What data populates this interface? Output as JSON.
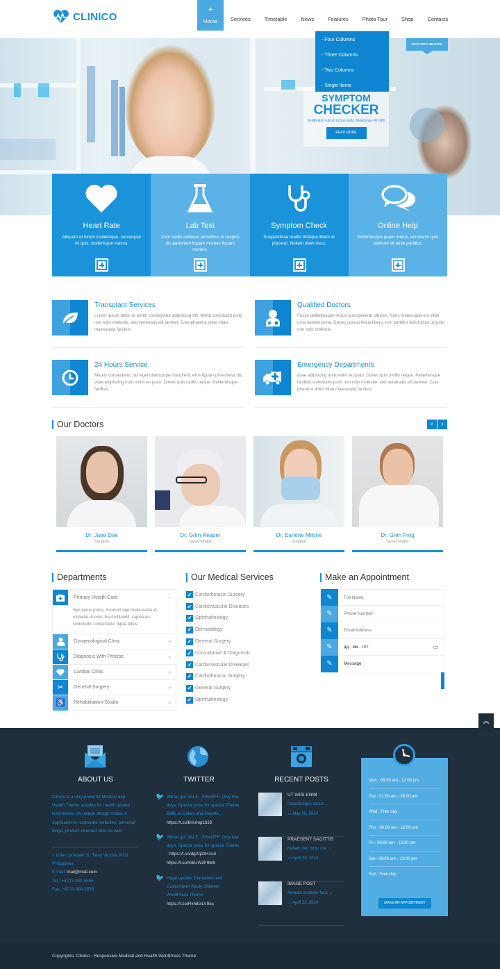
{
  "header": {
    "logo_text": "CLINICO",
    "nav": [
      {
        "label": "Home",
        "active": true
      },
      {
        "label": "Services"
      },
      {
        "label": "Timetable"
      },
      {
        "label": "News"
      },
      {
        "label": "Features"
      },
      {
        "label": "Photo Tour"
      },
      {
        "label": "Shop"
      },
      {
        "label": "Contacts"
      }
    ],
    "home_plus": "+",
    "dropdown": [
      "- Four Columns",
      "- Three Columns",
      "- Two Columns",
      "- Single Items"
    ]
  },
  "hero": {
    "doctors_search": "DOCTOR'S SEARCH",
    "symptom_line1": "SYMPTOM",
    "symptom_line2": "CHECKER",
    "symptom_sub": "Vestibulum rutrum luctus porta. Maecenas elit nibh",
    "read_more": "READ MORE"
  },
  "features": [
    {
      "icon": "heart-icon",
      "title": "Heart Rate",
      "desc": "Aliquam ut lorem scelerisque, consequat mi quis, scelerisque massa."
    },
    {
      "icon": "flask-icon",
      "title": "Lab Test",
      "desc": "Cum sociis natoque penatibus et magnis dis parturient liquam montes liquam montes."
    },
    {
      "icon": "stethoscope-icon",
      "title": "Symptom Check",
      "desc": "Suspendisse mattis tristique libero at placerat. Nullam diam risus."
    },
    {
      "icon": "chat-icon",
      "title": "Online Help",
      "desc": "Pellentesque quam metus, venenatis quis eleifend sit amet porttitor."
    }
  ],
  "services": [
    {
      "icon": "leaf-icon",
      "title": "Transplant Services",
      "desc": "Lorem ipsum dolor sit amet, consectetur adipiscing elit. Morbi sollicitudin justo non odio molestie, sed venenatis elit laoreet. Cras pharetra dolor vitae malesuada facilisis."
    },
    {
      "icon": "doctor-icon",
      "title": "Qualified Doctors",
      "desc": "Fusce pellentesque lectus quis placerat ultrices. Nunc malesuada est vitae urna laoreet porta. Donec cursus tellus libero, non porttitor felis luctus ut justo non odio molestie."
    },
    {
      "icon": "clock-icon",
      "title": "24 Hours Service",
      "desc": "Mauris consectetur, dui eget ullamcorper hendrerit, eros ligula consectetur dui, vitae adipiscing nunc enim eu justo. Donec quis mollis neque. Pellentesque facilisis."
    },
    {
      "icon": "ambulance-icon",
      "title": "Emergency Departments",
      "desc": "vitae adipiscing nunc enim eu justo. Donec quis mollis neque. Pellentesque facilisis,sollicitudin justo non odio molestie, sed venenatis elit laoreet. Cras pharetra dolor vitae malesuada facilisis."
    }
  ],
  "doctors": {
    "title": "Our Doctors",
    "prev": "‹",
    "next": "›",
    "items": [
      {
        "name": "Dr. Jane Doe",
        "role": "Surgeon"
      },
      {
        "name": "Dr. Grim Reaper",
        "role": "Gynecologist"
      },
      {
        "name": "Dr. Earlene Milone",
        "role": "Surgeon"
      },
      {
        "name": "Dr. Grim Frog",
        "role": "Gynecologist"
      }
    ]
  },
  "departments": {
    "title": "Departments",
    "items": [
      {
        "icon": "medkit-icon",
        "label": "Primary Health Care",
        "toggle": "−",
        "open": true,
        "body": "Sed purus purus, tincidunt eget malesuada et, molestie ut eros. Fusce blandit, sapien eu sollicitudin consectetur, ligula tellus."
      },
      {
        "icon": "user-md-icon",
        "label": "Gynaecological Clinic",
        "toggle": "+"
      },
      {
        "icon": "stethoscope-icon",
        "label": "Diagnosis With Precise",
        "toggle": "+"
      },
      {
        "icon": "heart-icon",
        "label": "Cardiac Clinic",
        "toggle": "+"
      },
      {
        "icon": "scissors-icon",
        "label": "General Surgery",
        "toggle": "+"
      },
      {
        "icon": "wheelchair-icon",
        "label": "Rehabilitation Studio",
        "toggle": "+"
      }
    ]
  },
  "medical_services": {
    "title": "Our Medical Services",
    "items": [
      "Cardiothoracic Surgery",
      "Cardiovascular Diseases",
      "Ophthalmology",
      "Dermatology",
      "General Surgery",
      "Consultative & Diagnostic",
      "Cardiovascular Diseases",
      "Cardiothoracic Surgery",
      "General Surgery",
      "Ophthalmology"
    ]
  },
  "appointment": {
    "title": "Make an Appointment",
    "fields": [
      {
        "placeholder": "Full Name"
      },
      {
        "placeholder": "Phone Number"
      },
      {
        "placeholder": "Email Address"
      },
      {
        "placeholder": "дд . мм . гггг"
      },
      {
        "placeholder": "Message"
      }
    ]
  },
  "scroll_top": "»",
  "footer": {
    "about": {
      "title": "ABOUT US",
      "text": "Clinico is a very powerful Medical and Health Theme suitable for health related businesses. Its unique design makes it applicable for corporate websites, personal blogs, product-oriented sites as well.",
      "address": "Little Lonsdale St, Talay Victoria 8011 Philippines",
      "email_label": "E-mail:",
      "email": "mail@mail.com",
      "tel_label": "Tel.:",
      "tel": "+4723-000-5555",
      "fax_label": "Fax:",
      "fax": "+4723-000-5556"
    },
    "twitter": {
      "title": "TWITTER",
      "tweets": [
        {
          "text": "We've got SALE - 50%OFF. Only few days. Special price for special Theme Bella la Cakes and Sweets ...",
          "link": "https://t.co/BvUmp18J8"
        },
        {
          "text": "We've got SALE - 50%OFF. Only few days. Special price for special Theme -",
          "link": "https://t.co/dgXq2zH1u4 https://t.co/SIkUW2F9M9"
        },
        {
          "text": "Huge update: Elementor and Customizer! Kiddy Children WordPress Theme -",
          "link": "https://t.co/Rxh8GLV9xa"
        }
      ]
    },
    "recent_posts": {
      "title": "RECENT POSTS",
      "posts": [
        {
          "title": "UT WISI ENIM",
          "excerpt": "Pellentesque varius →",
          "date": "May 29, 2014"
        },
        {
          "title": "PRAESENT SAGITTIS",
          "excerpt": "Nullam nec tortor ma →",
          "date": "April 29, 2014"
        },
        {
          "title": "IMAGE POST",
          "excerpt": "Aenean molestie fauc →",
          "date": "April 23, 2014"
        }
      ]
    },
    "hours": {
      "rows": [
        "Mon : 08:00 am - 12:00 pm",
        "Tue : 01:00 am - 05:00 pm",
        "Wed : Free day",
        "Thu : 08:00 am - 12:00 pm",
        "Fri : 08:00 am - 12:00 pm",
        "Sat : 08:00 am - 12:00 pm",
        "Sun : Free day"
      ],
      "button": "MAKE AN APPOINTMENT"
    },
    "copyright": "Copyrights: Clinico - Responsive Medical and Health WordPress Theme"
  },
  "colors": {
    "accent": "#1a8fd8",
    "accent_dark": "#0f86d1",
    "accent_light": "#5ab2e6",
    "footer_bg": "#1f2f3d"
  }
}
